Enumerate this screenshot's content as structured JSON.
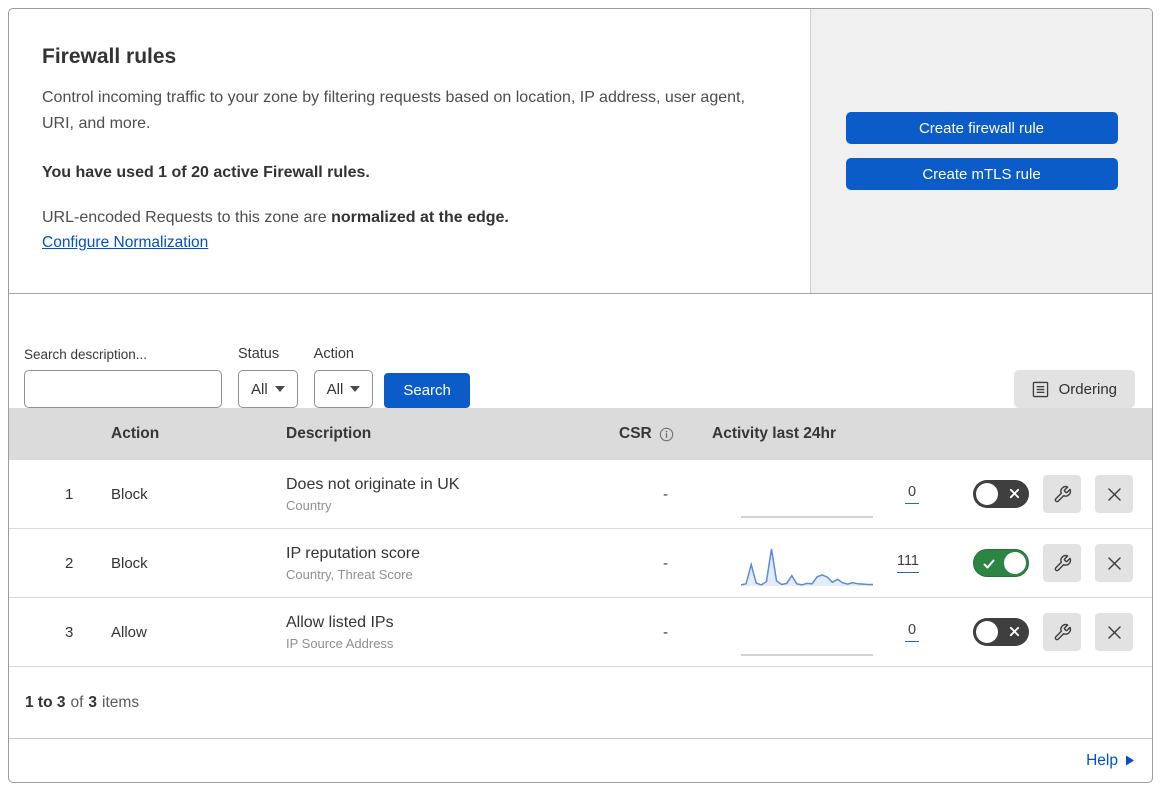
{
  "panel": {
    "title": "Firewall rules",
    "description": "Control incoming traffic to your zone by filtering requests based on location, IP address, user agent, URI, and more.",
    "usage_note": "You have used 1 of 20 active Firewall rules.",
    "normalization_prefix": "URL-encoded Requests to this zone are ",
    "normalization_bold": "normalized at the edge.",
    "normalization_link": "Configure Normalization",
    "buttons": {
      "create_firewall_rule": "Create firewall rule",
      "create_mtls_rule": "Create mTLS rule"
    }
  },
  "filters": {
    "search_label": "Search description...",
    "search_value": "",
    "status_label": "Status",
    "status_value": "All",
    "action_label": "Action",
    "action_value": "All",
    "search_button_label": "Search",
    "ordering_button_label": "Ordering"
  },
  "table": {
    "columns": {
      "action": "Action",
      "description": "Description",
      "csr": "CSR",
      "activity": "Activity last 24hr"
    },
    "rows": [
      {
        "index": "1",
        "action": "Block",
        "title": "Does not originate in UK",
        "subtitle": "Country",
        "csr": "-",
        "activity_count": "0",
        "enabled": false,
        "sparkline": [
          0,
          0,
          0,
          0,
          0,
          0,
          0,
          0,
          0,
          0,
          0,
          0,
          0,
          0,
          0,
          0,
          0,
          0,
          0,
          0,
          0,
          0,
          0,
          0,
          0,
          0,
          0
        ]
      },
      {
        "index": "2",
        "action": "Block",
        "title": "IP reputation score",
        "subtitle": "Country, Threat Score",
        "csr": "-",
        "activity_count": "111",
        "enabled": true,
        "sparkline": [
          3,
          6,
          58,
          8,
          3,
          12,
          100,
          14,
          4,
          7,
          28,
          6,
          3,
          7,
          6,
          25,
          30,
          24,
          10,
          18,
          9,
          5,
          9,
          6,
          5,
          4,
          4
        ]
      },
      {
        "index": "3",
        "action": "Allow",
        "title": "Allow listed IPs",
        "subtitle": "IP Source Address",
        "csr": "-",
        "activity_count": "0",
        "enabled": false,
        "sparkline": [
          0,
          0,
          0,
          0,
          0,
          0,
          0,
          0,
          0,
          0,
          0,
          0,
          0,
          0,
          0,
          0,
          0,
          0,
          0,
          0,
          0,
          0,
          0,
          0,
          0,
          0,
          0
        ]
      }
    ]
  },
  "footer": {
    "range": "1 to 3",
    "of": "of",
    "total": "3",
    "items": "items",
    "help_label": "Help"
  },
  "colors": {
    "primary_button_blue": "#0b5cc8",
    "link_blue": "#0051c3",
    "toggle_on_green": "#2d8543",
    "toggle_off_gray": "#3f3f3f",
    "sparkline_blue": "#5b8bd9",
    "table_header_bg": "#dbdbdb",
    "side_panel_bg": "#f0f0f0"
  },
  "icons": {
    "search": "magnifying-glass",
    "dropdown_caret": "triangle-down",
    "ordering": "list-document",
    "csr_info": "info-circle",
    "edit": "wrench",
    "delete": "x-mark",
    "toggle_on": "check-mark",
    "toggle_off": "x-mark",
    "help": "triangle-right"
  }
}
